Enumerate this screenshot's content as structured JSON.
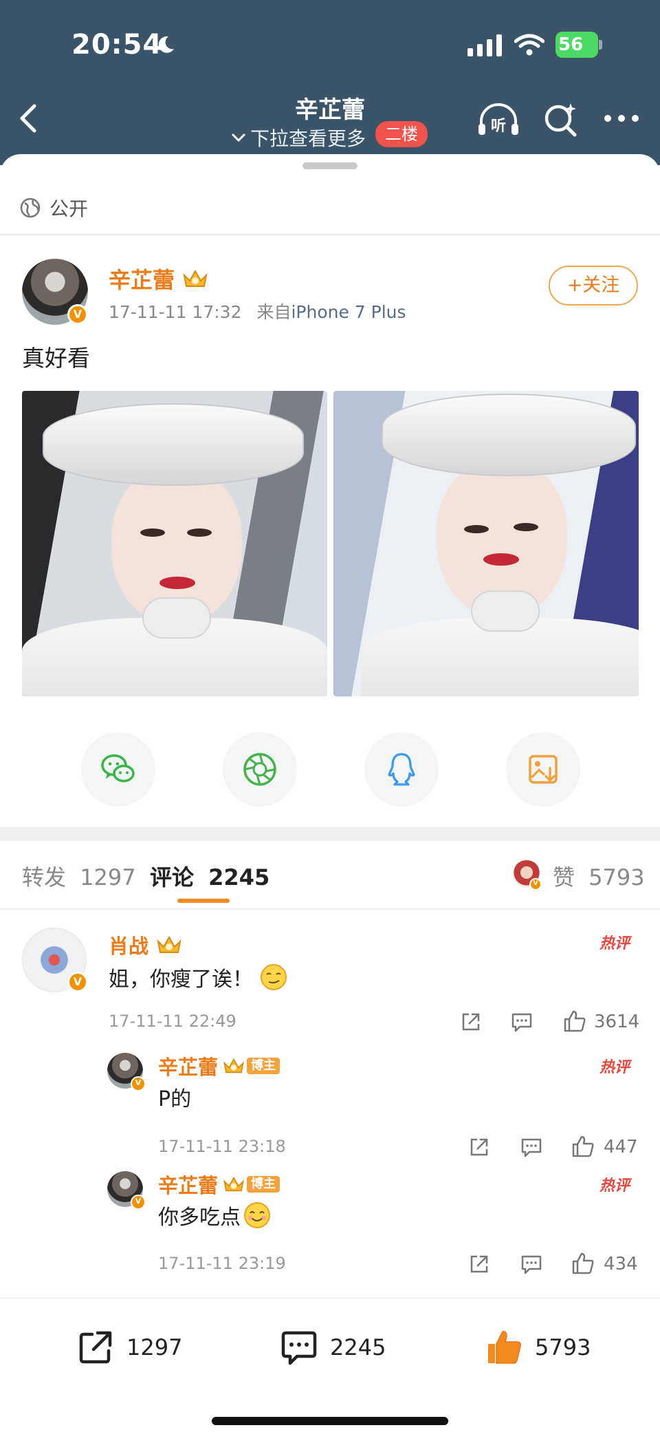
{
  "status_bar": {
    "time": "20:54",
    "battery": "56"
  },
  "nav": {
    "title": "辛芷蕾",
    "subtitle": "下拉查看更多",
    "floor_badge": "二楼",
    "listen_label": "听"
  },
  "privacy": {
    "label": "公开"
  },
  "post": {
    "author": "辛芷蕾",
    "time": "17-11-11 17:32",
    "source_prefix": "来自",
    "source": "iPhone 7 Plus",
    "follow_label": "+关注",
    "text": "真好看",
    "verified_badge": "V"
  },
  "tabs": {
    "repost_label": "转发",
    "repost_count": "1297",
    "comment_label": "评论",
    "comment_count": "2245",
    "like_label": "赞",
    "like_count": "5793"
  },
  "comments": [
    {
      "name": "肖战",
      "text": "姐，你瘦了诶！",
      "time": "17-11-11 22:49",
      "likes": "3614",
      "hot": "热评"
    },
    {
      "name": "辛芷蕾",
      "tag": "博主",
      "text": "P的",
      "time": "17-11-11 23:18",
      "likes": "447",
      "hot": "热评"
    },
    {
      "name": "辛芷蕾",
      "tag": "博主",
      "text": "你多吃点",
      "time": "17-11-11 23:19",
      "likes": "434",
      "hot": "热评"
    }
  ],
  "bottom_bar": {
    "repost": "1297",
    "comment": "2245",
    "like": "5793"
  },
  "colors": {
    "header": "#3b5468",
    "accent": "#ec7b1a",
    "hot_red": "#e8473f",
    "like_orange": "#f28b1d"
  }
}
